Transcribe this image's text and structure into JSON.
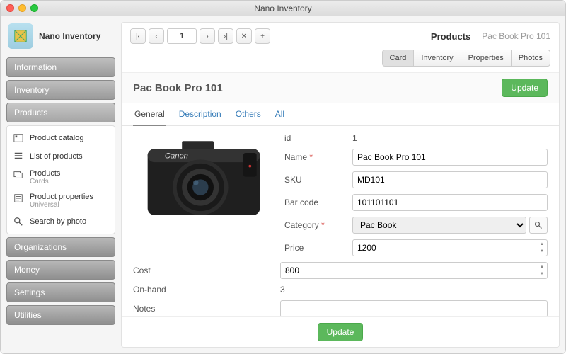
{
  "window": {
    "title": "Nano Inventory"
  },
  "app": {
    "name": "Nano Inventory"
  },
  "sidebar": {
    "nav": {
      "information": "Information",
      "inventory": "Inventory",
      "products": "Products",
      "organizations": "Organizations",
      "money": "Money",
      "settings": "Settings",
      "utilities": "Utilities"
    },
    "products_sub": {
      "catalog": "Product catalog",
      "list": "List of products",
      "products": "Products",
      "products_sub": "Cards",
      "properties": "Product properties",
      "properties_sub": "Universal",
      "search_photo": "Search by photo"
    }
  },
  "toolbar": {
    "page": "1"
  },
  "breadcrumb": {
    "section": "Products",
    "item": "Pac Book Pro 101"
  },
  "viewtabs": {
    "card": "Card",
    "inventory": "Inventory",
    "properties": "Properties",
    "photos": "Photos"
  },
  "header": {
    "title": "Pac Book Pro 101",
    "update": "Update"
  },
  "tabs": {
    "general": "General",
    "description": "Description",
    "others": "Others",
    "all": "All"
  },
  "form": {
    "labels": {
      "id": "id",
      "name": "Name",
      "sku": "SKU",
      "barcode": "Bar code",
      "category": "Category",
      "price": "Price",
      "cost": "Cost",
      "onhand": "On-hand",
      "notes": "Notes"
    },
    "values": {
      "id": "1",
      "name": "Pac Book Pro 101",
      "sku": "MD101",
      "barcode": "101101101",
      "category": "Pac Book",
      "price": "1200",
      "cost": "800",
      "onhand": "3",
      "notes": ""
    }
  },
  "footer": {
    "update": "Update"
  },
  "image": {
    "brand": "Canon"
  }
}
